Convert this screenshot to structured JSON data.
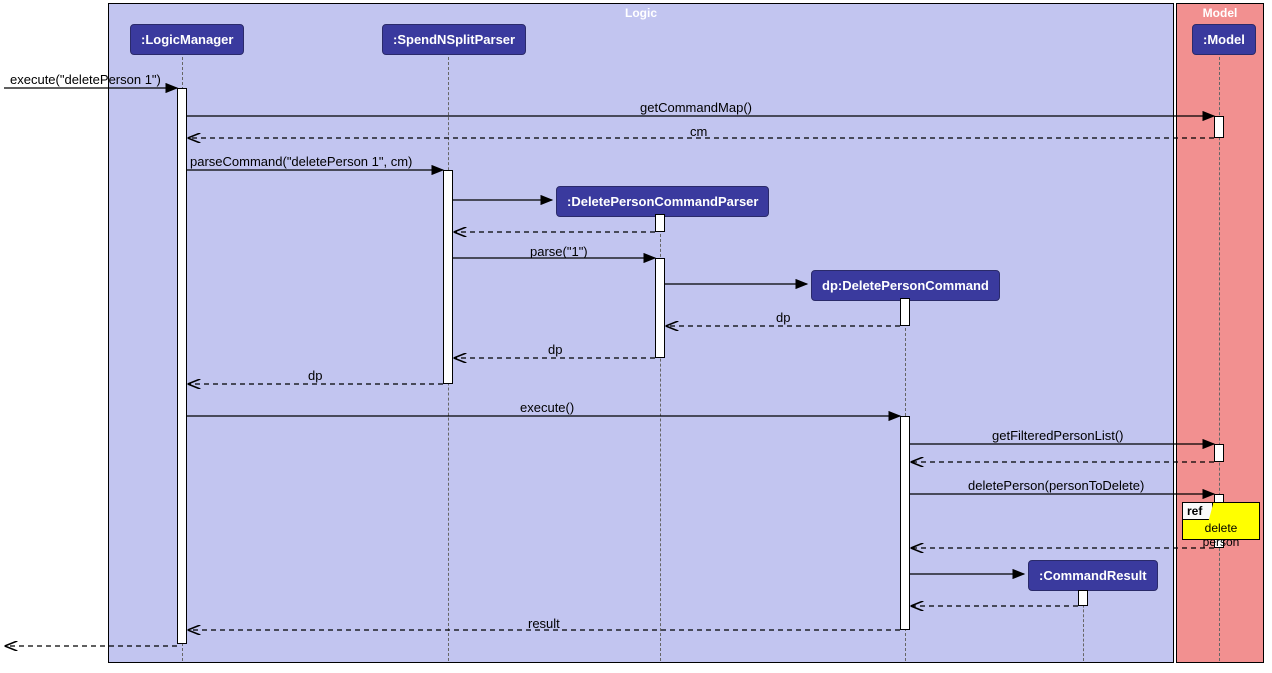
{
  "diagram_type": "UML Sequence Diagram",
  "frames": {
    "logic": {
      "title": "Logic"
    },
    "model": {
      "title": "Model"
    }
  },
  "participants": {
    "logicManager": ":LogicManager",
    "spendNSplitParser": ":SpendNSplitParser",
    "deletePersonCommandParser": ":DeletePersonCommandParser",
    "deletePersonCommand": "dp:DeletePersonCommand",
    "commandResult": ":CommandResult",
    "model": ":Model"
  },
  "messages": {
    "m1": "execute(\"deletePerson 1\")",
    "m2": "getCommandMap()",
    "m3": "cm",
    "m4": "parseCommand(\"deletePerson 1\", cm)",
    "m5": "parse(\"1\")",
    "m6": "dp",
    "m7": "dp",
    "m8": "dp",
    "m9": "execute()",
    "m10": "getFilteredPersonList()",
    "m11": "deletePerson(personToDelete)",
    "m12": "result"
  },
  "ref": {
    "label": "ref",
    "content": "delete person"
  }
}
